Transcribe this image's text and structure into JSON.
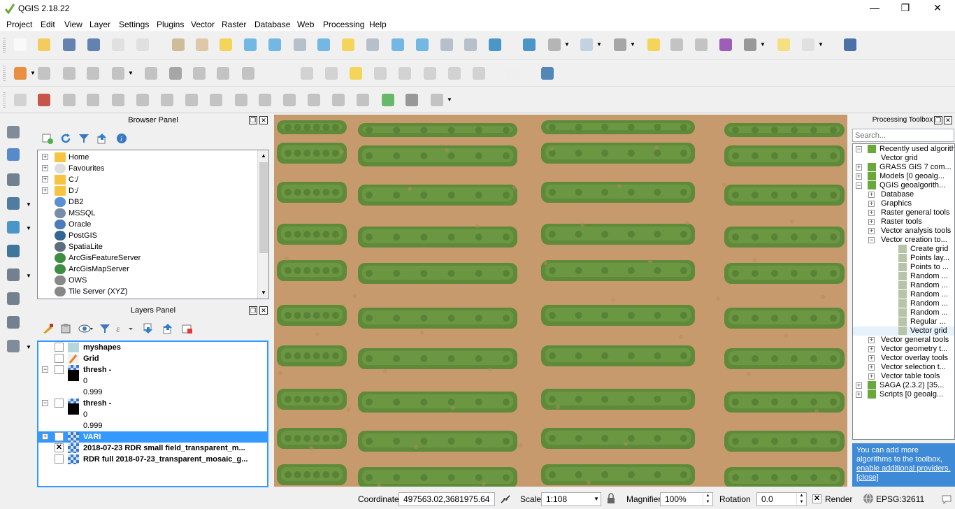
{
  "window": {
    "title": "QGIS 2.18.22",
    "minimize_label": "—",
    "maximize_label": "❐",
    "close_label": "✕"
  },
  "menu": [
    "Project",
    "Edit",
    "View",
    "Layer",
    "Settings",
    "Plugins",
    "Vector",
    "Raster",
    "Database",
    "Web",
    "Processing",
    "Help"
  ],
  "browser_panel": {
    "title": "Browser Panel",
    "items": [
      {
        "label": "Home",
        "icon": "folder-icon"
      },
      {
        "label": "Favourites",
        "icon": "star-icon"
      },
      {
        "label": "C:/",
        "icon": "folder-icon"
      },
      {
        "label": "D:/",
        "icon": "folder-icon"
      },
      {
        "label": "DB2",
        "icon": "db2-icon"
      },
      {
        "label": "MSSQL",
        "icon": "mssql-icon"
      },
      {
        "label": "Oracle",
        "icon": "oracle-icon"
      },
      {
        "label": "PostGIS",
        "icon": "postgis-icon"
      },
      {
        "label": "SpatiaLite",
        "icon": "spatialite-icon"
      },
      {
        "label": "ArcGisFeatureServer",
        "icon": "arcgis-icon"
      },
      {
        "label": "ArcGisMapServer",
        "icon": "arcgis-icon"
      },
      {
        "label": "OWS",
        "icon": "globe-icon"
      },
      {
        "label": "Tile Server (XYZ)",
        "icon": "globe-icon"
      }
    ]
  },
  "layers_panel": {
    "title": "Layers Panel",
    "layers": [
      {
        "name": "myshapes",
        "checked": false,
        "bold": true
      },
      {
        "name": "Grid",
        "checked": false,
        "bold": true
      },
      {
        "name": "thresh -",
        "checked": false,
        "bold": true
      },
      {
        "legend": "0"
      },
      {
        "legend": "0.999"
      },
      {
        "name": "thresh -",
        "checked": false,
        "bold": true
      },
      {
        "legend": "0"
      },
      {
        "legend": "0.999"
      },
      {
        "name": "VARI",
        "checked": false,
        "bold": true,
        "selected": true
      },
      {
        "name": "2018-07-23 RDR small field_transparent_m...",
        "checked": true,
        "bold": true
      },
      {
        "name": "RDR full 2018-07-23_transparent_mosaic_g...",
        "checked": false,
        "bold": true
      }
    ]
  },
  "processing_toolbox": {
    "title": "Processing Toolbox",
    "search_placeholder": "Search...",
    "items": [
      {
        "label": "Recently used algorith...",
        "level": 0,
        "exp": "−"
      },
      {
        "label": "Vector grid",
        "level": 1,
        "exp": ""
      },
      {
        "label": "GRASS GIS 7 com...",
        "level": 0,
        "exp": "+"
      },
      {
        "label": "Models [0 geoalg...",
        "level": 0,
        "exp": "+"
      },
      {
        "label": "QGIS geoalgorith...",
        "level": 0,
        "exp": "−"
      },
      {
        "label": "Database",
        "level": 1,
        "exp": "+"
      },
      {
        "label": "Graphics",
        "level": 1,
        "exp": "+"
      },
      {
        "label": "Raster general tools",
        "level": 1,
        "exp": "+"
      },
      {
        "label": "Raster tools",
        "level": 1,
        "exp": "+"
      },
      {
        "label": "Vector analysis tools",
        "level": 1,
        "exp": "+"
      },
      {
        "label": "Vector creation to...",
        "level": 1,
        "exp": "−"
      },
      {
        "label": "Create grid",
        "level": 2,
        "exp": ""
      },
      {
        "label": "Points lay...",
        "level": 2,
        "exp": ""
      },
      {
        "label": "Points to ...",
        "level": 2,
        "exp": ""
      },
      {
        "label": "Random ...",
        "level": 2,
        "exp": ""
      },
      {
        "label": "Random ...",
        "level": 2,
        "exp": ""
      },
      {
        "label": "Random ...",
        "level": 2,
        "exp": ""
      },
      {
        "label": "Random ...",
        "level": 2,
        "exp": ""
      },
      {
        "label": "Random ...",
        "level": 2,
        "exp": ""
      },
      {
        "label": "Regular ...",
        "level": 2,
        "exp": ""
      },
      {
        "label": "Vector grid",
        "level": 2,
        "exp": "",
        "selected": true
      },
      {
        "label": "Vector general tools",
        "level": 1,
        "exp": "+"
      },
      {
        "label": "Vector geometry t...",
        "level": 1,
        "exp": "+"
      },
      {
        "label": "Vector overlay tools",
        "level": 1,
        "exp": "+"
      },
      {
        "label": "Vector selection t...",
        "level": 1,
        "exp": "+"
      },
      {
        "label": "Vector table tools",
        "level": 1,
        "exp": "+"
      },
      {
        "label": "SAGA (2.3.2) [35...",
        "level": 0,
        "exp": "+"
      },
      {
        "label": "Scripts [0 geoalg...",
        "level": 0,
        "exp": "+"
      }
    ],
    "info_text": "You can add more algorithms to the toolbox,",
    "info_link": "enable additional providers.",
    "info_close": "[close]"
  },
  "statusbar": {
    "coordinate_label": "Coordinate",
    "coordinate_value": "497563.02,3681975.64",
    "scale_label": "Scale",
    "scale_value": "1:108",
    "magnifier_label": "Magnifier",
    "magnifier_value": "100%",
    "rotation_label": "Rotation",
    "rotation_value": "0.0",
    "render_label": "Render",
    "render_checked": true,
    "epsg_label": "EPSG:32611"
  },
  "colors": {
    "soil": "#c79a6b",
    "crop": "#5f8a3a",
    "selection": "#3399ff",
    "link": "#1a0dab",
    "info_bg": "#3e8ad6"
  }
}
